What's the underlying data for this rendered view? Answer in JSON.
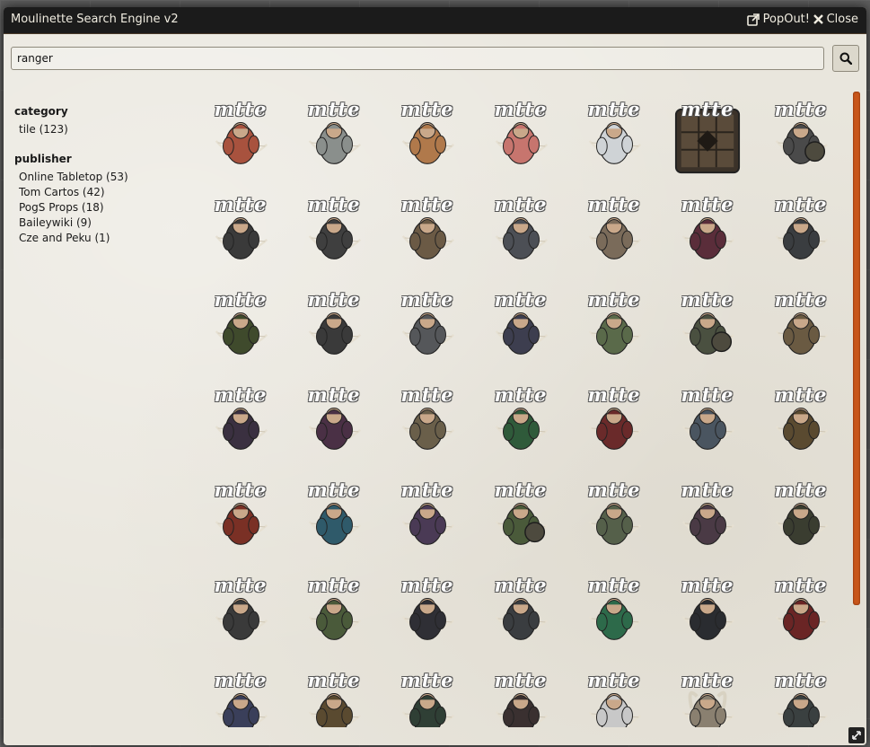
{
  "window": {
    "title": "Moulinette Search Engine v2",
    "popout_label": "PopOut!",
    "close_label": "Close"
  },
  "search": {
    "value": "ranger",
    "button_icon": "search-icon"
  },
  "filters": {
    "category": {
      "title": "category",
      "items": [
        {
          "label": "tile (123)"
        }
      ]
    },
    "publisher": {
      "title": "publisher",
      "items": [
        {
          "label": "Online Tabletop (53)"
        },
        {
          "label": "Tom Cartos (42)"
        },
        {
          "label": "PogS Props (18)"
        },
        {
          "label": "Baileywiki (9)"
        },
        {
          "label": "Cze and Peku (1)"
        }
      ]
    }
  },
  "results": {
    "watermark": "mtte",
    "tiles": [
      {
        "kind": "archer",
        "color": "#a8523e"
      },
      {
        "kind": "archer",
        "color": "#8a8f8c"
      },
      {
        "kind": "archer",
        "color": "#b0794b"
      },
      {
        "kind": "archer",
        "color": "#c7756e"
      },
      {
        "kind": "archer",
        "color": "#cfd3d6"
      },
      {
        "kind": "map",
        "color": "#5a4b3a"
      },
      {
        "kind": "shield",
        "color": "#4a4a4a"
      },
      {
        "kind": "archer",
        "color": "#3a3a3a"
      },
      {
        "kind": "archer",
        "color": "#3f3f3f"
      },
      {
        "kind": "archer",
        "color": "#6b5a45"
      },
      {
        "kind": "archer",
        "color": "#4c4f55"
      },
      {
        "kind": "archer",
        "color": "#7a6b5a"
      },
      {
        "kind": "archer",
        "color": "#5a2d3a"
      },
      {
        "kind": "archer",
        "color": "#3a3d40"
      },
      {
        "kind": "archer",
        "color": "#3f4a2c"
      },
      {
        "kind": "archer",
        "color": "#3a3a3a"
      },
      {
        "kind": "archer",
        "color": "#55575a"
      },
      {
        "kind": "archer",
        "color": "#3d3e4f"
      },
      {
        "kind": "archer",
        "color": "#5a6a4a"
      },
      {
        "kind": "shield",
        "color": "#4a5040"
      },
      {
        "kind": "archer",
        "color": "#6a5a42"
      },
      {
        "kind": "archer",
        "color": "#3a3040"
      },
      {
        "kind": "archer",
        "color": "#4a3045"
      },
      {
        "kind": "archer",
        "color": "#6a5f4a"
      },
      {
        "kind": "archer",
        "color": "#2f5a3a"
      },
      {
        "kind": "archer",
        "color": "#6a2a2a"
      },
      {
        "kind": "archer",
        "color": "#4a5560"
      },
      {
        "kind": "archer",
        "color": "#5a4a30"
      },
      {
        "kind": "archer",
        "color": "#7a3025"
      },
      {
        "kind": "archer",
        "color": "#2f5a6a"
      },
      {
        "kind": "archer",
        "color": "#4a3a55"
      },
      {
        "kind": "shield",
        "color": "#4a5a3a"
      },
      {
        "kind": "archer",
        "color": "#55604a"
      },
      {
        "kind": "archer",
        "color": "#4a3a45"
      },
      {
        "kind": "archer",
        "color": "#3a3d30"
      },
      {
        "kind": "archer",
        "color": "#3a3a3a"
      },
      {
        "kind": "archer",
        "color": "#4a5a3a"
      },
      {
        "kind": "archer",
        "color": "#2f2f35"
      },
      {
        "kind": "archer",
        "color": "#3a3d40"
      },
      {
        "kind": "archer",
        "color": "#2d6a4a"
      },
      {
        "kind": "archer",
        "color": "#2a2c30"
      },
      {
        "kind": "archer",
        "color": "#6a2525"
      },
      {
        "kind": "archer",
        "color": "#3a3f5a"
      },
      {
        "kind": "archer",
        "color": "#5a4a30"
      },
      {
        "kind": "archer",
        "color": "#2f3f35"
      },
      {
        "kind": "archer",
        "color": "#3a3030"
      },
      {
        "kind": "archer",
        "color": "#c8c8c8"
      },
      {
        "kind": "horns",
        "color": "#8a8070"
      },
      {
        "kind": "archer",
        "color": "#3a4040"
      }
    ]
  },
  "icons": {
    "popout": "external-link-icon",
    "close": "close-icon",
    "resize": "resize-icon"
  }
}
